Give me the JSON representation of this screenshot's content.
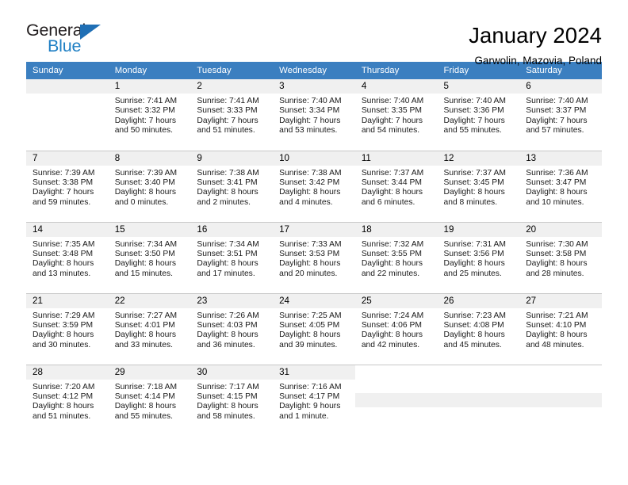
{
  "brand": {
    "name_part1": "General",
    "name_part2": "Blue",
    "triangle_color": "#1f6fb5",
    "blue_text_color": "#1f7fc4"
  },
  "header": {
    "title": "January 2024",
    "subtitle": "Garwolin, Mazovia, Poland",
    "header_bg": "#3b7fc0",
    "daynum_bg": "#f0f0f0"
  },
  "weekdays": [
    "Sunday",
    "Monday",
    "Tuesday",
    "Wednesday",
    "Thursday",
    "Friday",
    "Saturday"
  ],
  "weeks": [
    [
      {
        "day": "",
        "empty": true
      },
      {
        "day": "1",
        "sunrise": "Sunrise: 7:41 AM",
        "sunset": "Sunset: 3:32 PM",
        "daylight1": "Daylight: 7 hours",
        "daylight2": "and 50 minutes."
      },
      {
        "day": "2",
        "sunrise": "Sunrise: 7:41 AM",
        "sunset": "Sunset: 3:33 PM",
        "daylight1": "Daylight: 7 hours",
        "daylight2": "and 51 minutes."
      },
      {
        "day": "3",
        "sunrise": "Sunrise: 7:40 AM",
        "sunset": "Sunset: 3:34 PM",
        "daylight1": "Daylight: 7 hours",
        "daylight2": "and 53 minutes."
      },
      {
        "day": "4",
        "sunrise": "Sunrise: 7:40 AM",
        "sunset": "Sunset: 3:35 PM",
        "daylight1": "Daylight: 7 hours",
        "daylight2": "and 54 minutes."
      },
      {
        "day": "5",
        "sunrise": "Sunrise: 7:40 AM",
        "sunset": "Sunset: 3:36 PM",
        "daylight1": "Daylight: 7 hours",
        "daylight2": "and 55 minutes."
      },
      {
        "day": "6",
        "sunrise": "Sunrise: 7:40 AM",
        "sunset": "Sunset: 3:37 PM",
        "daylight1": "Daylight: 7 hours",
        "daylight2": "and 57 minutes."
      }
    ],
    [
      {
        "day": "7",
        "sunrise": "Sunrise: 7:39 AM",
        "sunset": "Sunset: 3:38 PM",
        "daylight1": "Daylight: 7 hours",
        "daylight2": "and 59 minutes."
      },
      {
        "day": "8",
        "sunrise": "Sunrise: 7:39 AM",
        "sunset": "Sunset: 3:40 PM",
        "daylight1": "Daylight: 8 hours",
        "daylight2": "and 0 minutes."
      },
      {
        "day": "9",
        "sunrise": "Sunrise: 7:38 AM",
        "sunset": "Sunset: 3:41 PM",
        "daylight1": "Daylight: 8 hours",
        "daylight2": "and 2 minutes."
      },
      {
        "day": "10",
        "sunrise": "Sunrise: 7:38 AM",
        "sunset": "Sunset: 3:42 PM",
        "daylight1": "Daylight: 8 hours",
        "daylight2": "and 4 minutes."
      },
      {
        "day": "11",
        "sunrise": "Sunrise: 7:37 AM",
        "sunset": "Sunset: 3:44 PM",
        "daylight1": "Daylight: 8 hours",
        "daylight2": "and 6 minutes."
      },
      {
        "day": "12",
        "sunrise": "Sunrise: 7:37 AM",
        "sunset": "Sunset: 3:45 PM",
        "daylight1": "Daylight: 8 hours",
        "daylight2": "and 8 minutes."
      },
      {
        "day": "13",
        "sunrise": "Sunrise: 7:36 AM",
        "sunset": "Sunset: 3:47 PM",
        "daylight1": "Daylight: 8 hours",
        "daylight2": "and 10 minutes."
      }
    ],
    [
      {
        "day": "14",
        "sunrise": "Sunrise: 7:35 AM",
        "sunset": "Sunset: 3:48 PM",
        "daylight1": "Daylight: 8 hours",
        "daylight2": "and 13 minutes."
      },
      {
        "day": "15",
        "sunrise": "Sunrise: 7:34 AM",
        "sunset": "Sunset: 3:50 PM",
        "daylight1": "Daylight: 8 hours",
        "daylight2": "and 15 minutes."
      },
      {
        "day": "16",
        "sunrise": "Sunrise: 7:34 AM",
        "sunset": "Sunset: 3:51 PM",
        "daylight1": "Daylight: 8 hours",
        "daylight2": "and 17 minutes."
      },
      {
        "day": "17",
        "sunrise": "Sunrise: 7:33 AM",
        "sunset": "Sunset: 3:53 PM",
        "daylight1": "Daylight: 8 hours",
        "daylight2": "and 20 minutes."
      },
      {
        "day": "18",
        "sunrise": "Sunrise: 7:32 AM",
        "sunset": "Sunset: 3:55 PM",
        "daylight1": "Daylight: 8 hours",
        "daylight2": "and 22 minutes."
      },
      {
        "day": "19",
        "sunrise": "Sunrise: 7:31 AM",
        "sunset": "Sunset: 3:56 PM",
        "daylight1": "Daylight: 8 hours",
        "daylight2": "and 25 minutes."
      },
      {
        "day": "20",
        "sunrise": "Sunrise: 7:30 AM",
        "sunset": "Sunset: 3:58 PM",
        "daylight1": "Daylight: 8 hours",
        "daylight2": "and 28 minutes."
      }
    ],
    [
      {
        "day": "21",
        "sunrise": "Sunrise: 7:29 AM",
        "sunset": "Sunset: 3:59 PM",
        "daylight1": "Daylight: 8 hours",
        "daylight2": "and 30 minutes."
      },
      {
        "day": "22",
        "sunrise": "Sunrise: 7:27 AM",
        "sunset": "Sunset: 4:01 PM",
        "daylight1": "Daylight: 8 hours",
        "daylight2": "and 33 minutes."
      },
      {
        "day": "23",
        "sunrise": "Sunrise: 7:26 AM",
        "sunset": "Sunset: 4:03 PM",
        "daylight1": "Daylight: 8 hours",
        "daylight2": "and 36 minutes."
      },
      {
        "day": "24",
        "sunrise": "Sunrise: 7:25 AM",
        "sunset": "Sunset: 4:05 PM",
        "daylight1": "Daylight: 8 hours",
        "daylight2": "and 39 minutes."
      },
      {
        "day": "25",
        "sunrise": "Sunrise: 7:24 AM",
        "sunset": "Sunset: 4:06 PM",
        "daylight1": "Daylight: 8 hours",
        "daylight2": "and 42 minutes."
      },
      {
        "day": "26",
        "sunrise": "Sunrise: 7:23 AM",
        "sunset": "Sunset: 4:08 PM",
        "daylight1": "Daylight: 8 hours",
        "daylight2": "and 45 minutes."
      },
      {
        "day": "27",
        "sunrise": "Sunrise: 7:21 AM",
        "sunset": "Sunset: 4:10 PM",
        "daylight1": "Daylight: 8 hours",
        "daylight2": "and 48 minutes."
      }
    ],
    [
      {
        "day": "28",
        "sunrise": "Sunrise: 7:20 AM",
        "sunset": "Sunset: 4:12 PM",
        "daylight1": "Daylight: 8 hours",
        "daylight2": "and 51 minutes."
      },
      {
        "day": "29",
        "sunrise": "Sunrise: 7:18 AM",
        "sunset": "Sunset: 4:14 PM",
        "daylight1": "Daylight: 8 hours",
        "daylight2": "and 55 minutes."
      },
      {
        "day": "30",
        "sunrise": "Sunrise: 7:17 AM",
        "sunset": "Sunset: 4:15 PM",
        "daylight1": "Daylight: 8 hours",
        "daylight2": "and 58 minutes."
      },
      {
        "day": "31",
        "sunrise": "Sunrise: 7:16 AM",
        "sunset": "Sunset: 4:17 PM",
        "daylight1": "Daylight: 9 hours",
        "daylight2": "and 1 minute."
      },
      {
        "day": "",
        "blank": true
      },
      {
        "day": "",
        "blank": true
      },
      {
        "day": "",
        "blank": true
      }
    ]
  ]
}
